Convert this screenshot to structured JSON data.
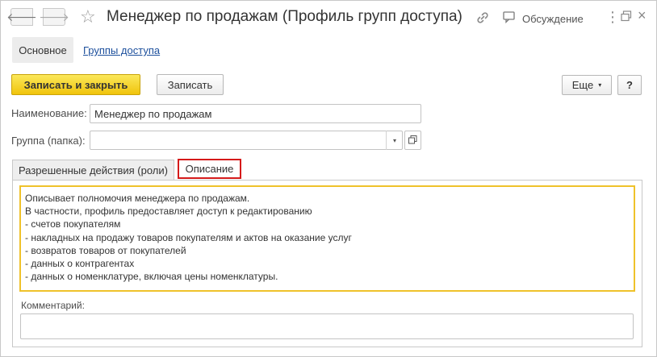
{
  "window": {
    "title": "Менеджер по продажам (Профиль групп доступа)",
    "discussion_label": "Обсуждение",
    "nav_back_glyph": "🡐",
    "nav_forward_glyph": "🡒",
    "star_glyph": "☆",
    "menu_glyph": "⋮",
    "close_glyph": "×"
  },
  "section_tabs": {
    "main": "Основное",
    "access_groups": "Группы доступа"
  },
  "toolbar": {
    "save_close_label": "Записать и закрыть",
    "save_label": "Записать",
    "more_label": "Еще",
    "more_caret": "▾",
    "help_label": "?"
  },
  "form": {
    "name_label": "Наименование:",
    "name_value": "Менеджер по продажам",
    "group_label": "Группа (папка):",
    "group_value": "",
    "dropdown_glyph": "▾"
  },
  "tabs": {
    "roles": "Разрешенные действия (роли)",
    "description": "Описание"
  },
  "description": {
    "lines": [
      "Описывает полномочия менеджера по продажам.",
      "В частности, профиль предоставляет доступ к редактированию",
      "- счетов покупателям",
      "- накладных на продажу товаров покупателям и актов на оказание услуг",
      "- возвратов товаров от покупателей",
      "- данных о контрагентах",
      "- данных о номенклатуре, включая цены номенклатуры."
    ]
  },
  "comment": {
    "label": "Комментарий:",
    "value": ""
  },
  "colors": {
    "primary_button": "#f0c40c",
    "highlight_border": "#d51a1a",
    "text_box_border": "#efc22a",
    "link": "#1c4f9c"
  }
}
